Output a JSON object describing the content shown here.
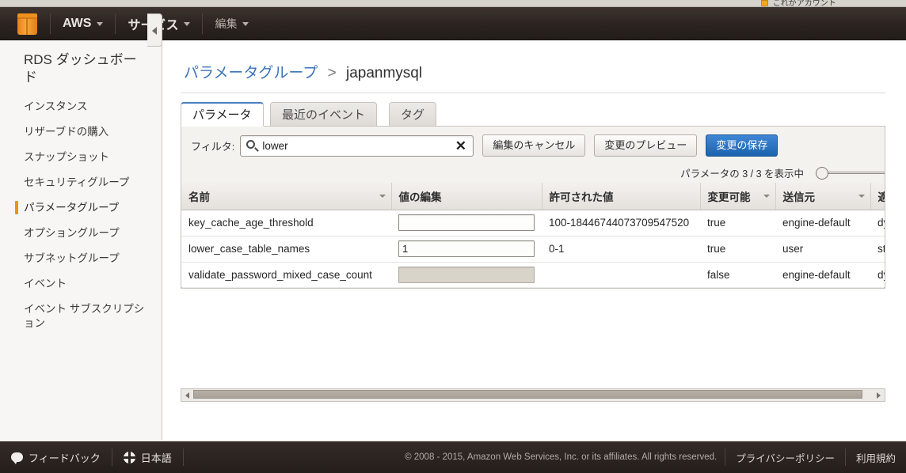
{
  "browser": {
    "bookmark_label": "これがアカウント"
  },
  "topnav": {
    "logo_name": "aws-cube-logo",
    "items": [
      {
        "label": "AWS",
        "has_caret": true,
        "style": "bold"
      },
      {
        "label": "サービス",
        "has_caret": true,
        "style": "bold"
      },
      {
        "label": "編集",
        "has_caret": true,
        "style": "dim"
      }
    ]
  },
  "sidebar": {
    "title": "RDS ダッシュボード",
    "collapse_icon": "chevron-left-icon",
    "items": [
      {
        "label": "インスタンス",
        "active": false
      },
      {
        "label": "リザーブドの購入",
        "active": false
      },
      {
        "label": "スナップショット",
        "active": false
      },
      {
        "label": "セキュリティグループ",
        "active": false
      },
      {
        "label": "パラメータグループ",
        "active": true
      },
      {
        "label": "オプショングループ",
        "active": false
      },
      {
        "label": "サブネットグループ",
        "active": false
      },
      {
        "label": "イベント",
        "active": false
      },
      {
        "label": "イベント サブスクリプション",
        "active": false
      }
    ]
  },
  "breadcrumb": {
    "parent": "パラメータグループ",
    "separator": ">",
    "current": "japanmysql"
  },
  "tabs": [
    {
      "label": "パラメータ",
      "active": true
    },
    {
      "label": "最近のイベント",
      "active": false
    },
    {
      "label": "タグ",
      "active": false
    }
  ],
  "toolbar": {
    "filter_label": "フィルタ:",
    "search_icon": "search-icon",
    "search_value": "lower",
    "clear_icon": "clear-x-icon",
    "cancel_edit_label": "編集のキャンセル",
    "preview_changes_label": "変更のプレビュー",
    "save_changes_label": "変更の保存",
    "primary_color": "#1c63ae"
  },
  "count": {
    "text": "パラメータの 3 / 3 を表示中",
    "slider_name": "page-size-slider"
  },
  "table": {
    "columns": [
      {
        "label": "名前",
        "sortable": true
      },
      {
        "label": "値の編集",
        "sortable": false
      },
      {
        "label": "許可された値",
        "sortable": false
      },
      {
        "label": "変更可能",
        "sortable": true
      },
      {
        "label": "送信元",
        "sortable": true
      },
      {
        "label": "適用",
        "sortable": false
      }
    ],
    "rows": [
      {
        "name": "key_cache_age_threshold",
        "edit_value": "",
        "input_disabled": false,
        "allowed_values": "100-18446744073709547520",
        "modifiable": "true",
        "source": "engine-default",
        "apply_type": "dyna"
      },
      {
        "name": "lower_case_table_names",
        "edit_value": "1",
        "input_disabled": false,
        "allowed_values": "0-1",
        "modifiable": "true",
        "source": "user",
        "apply_type": "static"
      },
      {
        "name": "validate_password_mixed_case_count",
        "edit_value": "",
        "input_disabled": true,
        "allowed_values": "",
        "modifiable": "false",
        "source": "engine-default",
        "apply_type": "dyna"
      }
    ]
  },
  "footer": {
    "feedback_label": "フィードバック",
    "feedback_icon": "speech-bubble-icon",
    "language_label": "日本語",
    "language_icon": "globe-icon",
    "copyright": "© 2008 - 2015, Amazon Web Services, Inc. or its affiliates. All rights reserved.",
    "links": [
      {
        "label": "プライバシーポリシー"
      },
      {
        "label": "利用規約"
      }
    ]
  }
}
